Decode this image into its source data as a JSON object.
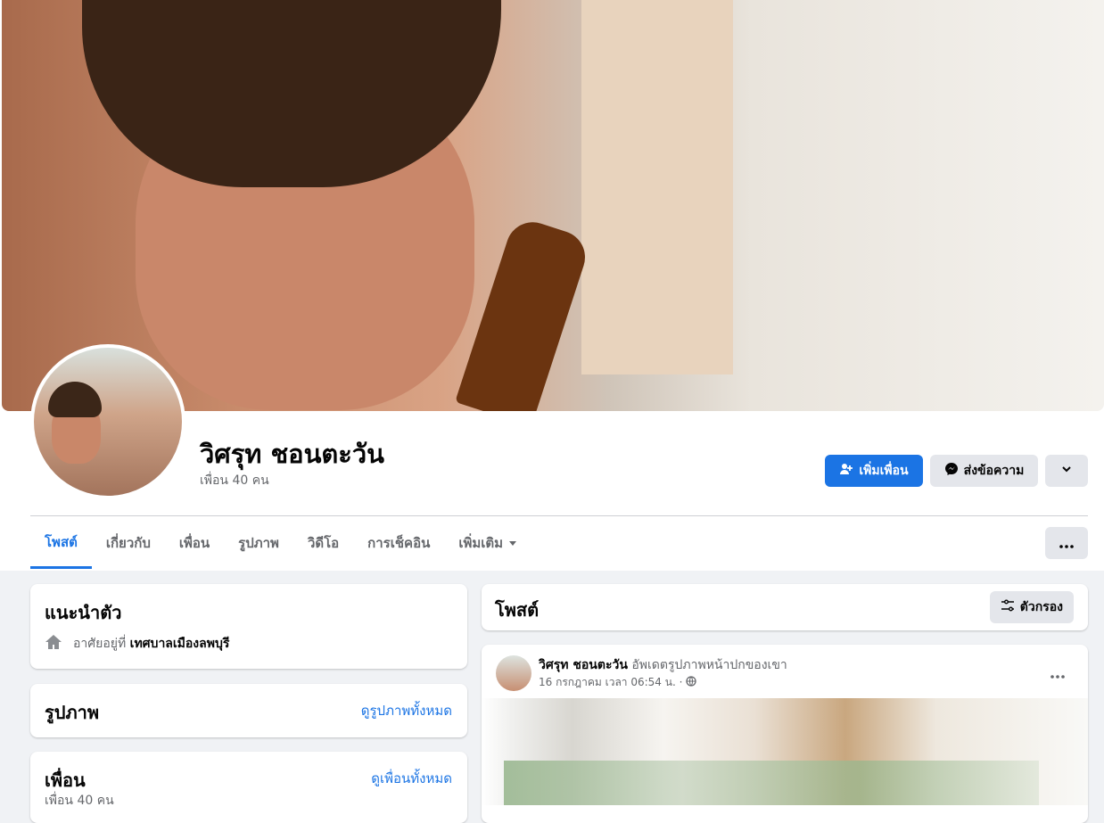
{
  "profile": {
    "name": "วิศรุท ชอนตะวัน",
    "friends_count": "เพื่อน 40 คน"
  },
  "actions": {
    "add_friend": "เพิ่มเพื่อน",
    "message": "ส่งข้อความ"
  },
  "tabs": [
    "โพสต์",
    "เกี่ยวกับ",
    "เพื่อน",
    "รูปภาพ",
    "วิดีโอ",
    "การเช็คอิน",
    "เพิ่มเติม"
  ],
  "intro": {
    "title": "แนะนำตัว",
    "lives_prefix": "อาศัยอยู่ที่",
    "lives_place": "เทศบาลเมืองลพบุรี"
  },
  "photos": {
    "title": "รูปภาพ",
    "see_all": "ดูรูปภาพทั้งหมด"
  },
  "friends": {
    "title": "เพื่อน",
    "see_all": "ดูเพื่อนทั้งหมด",
    "count": "เพื่อน 40 คน"
  },
  "posts": {
    "title": "โพสต์",
    "filter": "ตัวกรอง"
  },
  "post": {
    "author": "วิศรุท ชอนตะวัน",
    "action": "อัพเดตรูปภาพหน้าปกของเขา",
    "time": "16 กรกฎาคม เวลา 06:54 น. ·"
  },
  "icons": {
    "add_friend": "add-person-icon",
    "message": "messenger-icon",
    "menu": "chevron-down-icon",
    "more": "more-dots-icon",
    "home": "home-icon",
    "filter": "filter-icon",
    "privacy": "globe-icon"
  },
  "colors": {
    "accent": "#1b74e4",
    "background": "#f0f2f5",
    "secondary_text": "#65676b"
  }
}
